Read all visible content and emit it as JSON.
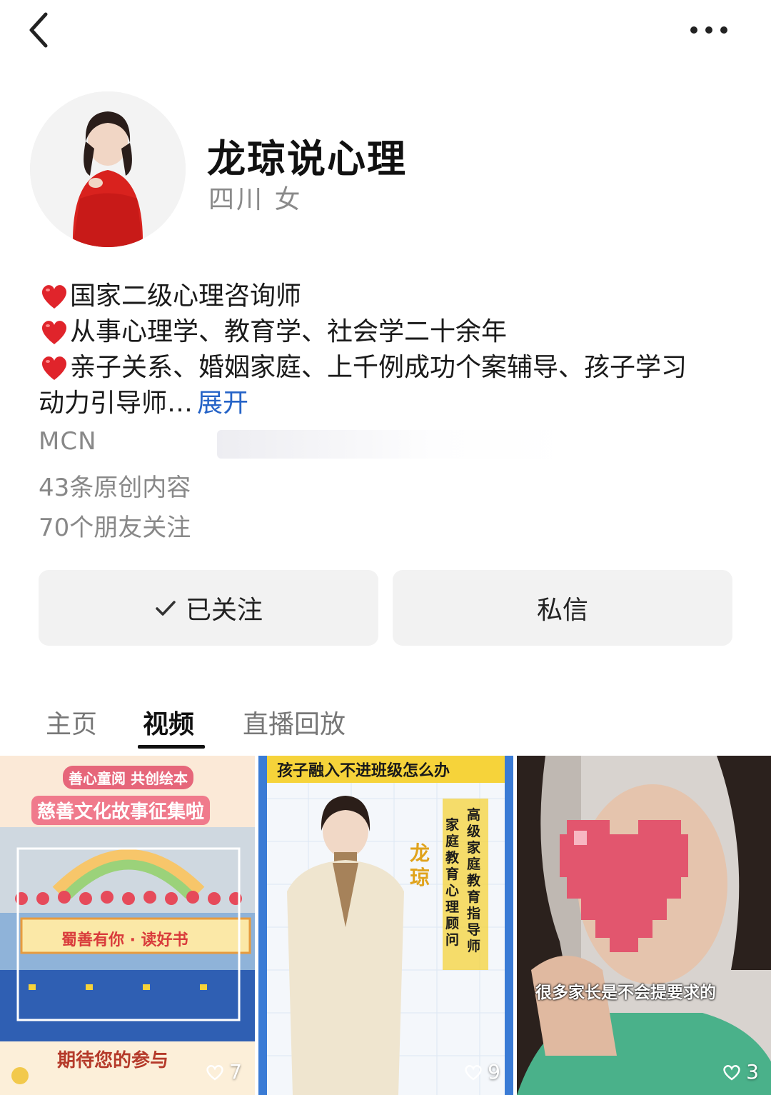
{
  "profile": {
    "name": "龙琼说心理",
    "meta": "四川 女",
    "bio": [
      "国家二级心理咨询师",
      "从事心理学、教育学、社会学二十余年",
      "亲子关系、婚姻家庭、上千例成功个案辅导、孩子学习"
    ],
    "bio_last": "动力引导师…",
    "expand_label": "展开",
    "mcn": "MCN",
    "original_count": "43条原创内容",
    "friends_follow": "70个朋友关注"
  },
  "actions": {
    "follow_label": "已关注",
    "message_label": "私信"
  },
  "tabs": [
    {
      "label": "主页",
      "active": false
    },
    {
      "label": "视频",
      "active": true
    },
    {
      "label": "直播回放",
      "active": false
    }
  ],
  "videos": [
    {
      "likes": "7",
      "tag_line1": "善心童阅",
      "tag_line2": "共创绘本",
      "headline": "慈善文化故事征集啦",
      "banner": "蜀善有你 · 读好书",
      "footer": "期待您的参与"
    },
    {
      "likes": "9",
      "headline": "孩子融入不进班级怎么办",
      "name_vertical": "龙琼",
      "title_col1": "家庭教育心理顾问",
      "title_col2": "高级家庭教育指导师"
    },
    {
      "likes": "3",
      "caption": "很多家长是不会提要求的"
    }
  ],
  "colors": {
    "accent_link": "#2563c7",
    "heart": "#e0242b",
    "button_bg": "#f2f2f2",
    "secondary_text": "#8a8a8a"
  },
  "icons": [
    "back-icon",
    "more-icon",
    "heart-emoji-icon",
    "check-icon",
    "like-heart-icon"
  ]
}
